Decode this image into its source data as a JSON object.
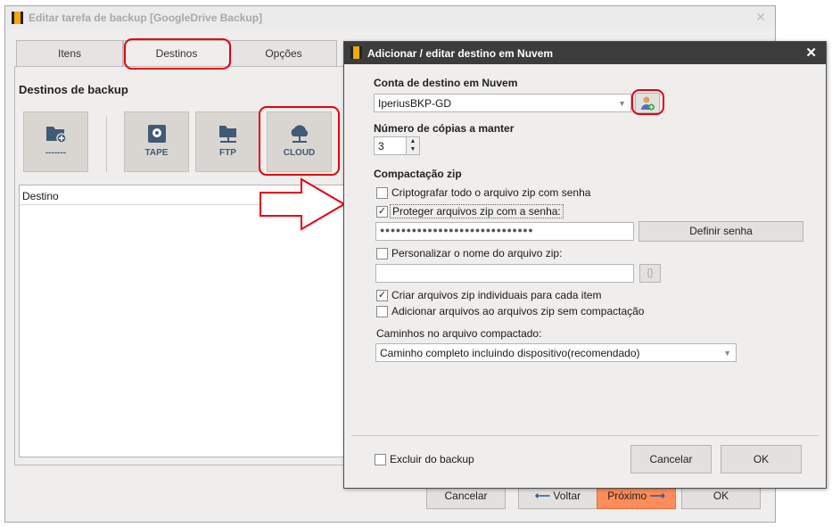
{
  "colors": {
    "accent_red": "#e8000c",
    "next_button": "#ff8c5a",
    "icon_blue": "#405a77",
    "dialog_title_bg": "#3c3c3c"
  },
  "bg": {
    "title": "Editar tarefa de backup   [GoogleDrive Backup]",
    "close": "✕",
    "tabs": [
      "Itens",
      "Destinos",
      "Opções"
    ],
    "section_title": "Destinos de backup",
    "toolbar": {
      "add_label": "-------",
      "tape": "TAPE",
      "ftp": "FTP",
      "cloud": "CLOUD"
    },
    "list_header": "Destino",
    "buttons": {
      "cancel": "Cancelar",
      "back": "Voltar",
      "next": "Próximo",
      "ok": "OK"
    }
  },
  "dlg": {
    "title": "Adicionar / editar destino em Nuvem",
    "close": "✕",
    "account_label": "Conta de destino em Nuvem",
    "account_value": "IperiusBKP-GD",
    "copies_label": "Número de cópias a manter",
    "copies_value": "3",
    "zip_section": "Compactação zip",
    "encrypt_all": "Criptografar todo o arquivo zip com senha",
    "protect_zip": "Proteger arquivos zip com a senha:",
    "password": "●●●●●●●●●●●●●●●●●●●●●●●●●●●●●",
    "set_password": "Definir senha",
    "custom_name": "Personalizar o nome do arquivo zip:",
    "custom_name_value": "",
    "braces": "{}",
    "individual_zip": "Criar arquivos zip individuais para cada item",
    "no_compression": "Adicionar arquivos ao arquivos zip sem compactação",
    "paths_label": "Caminhos no arquivo compactado:",
    "paths_value": "Caminho completo incluindo dispositivo(recomendado)",
    "exclude": "Excluir do backup",
    "cancel": "Cancelar",
    "ok": "OK",
    "check_mark": "✓"
  }
}
